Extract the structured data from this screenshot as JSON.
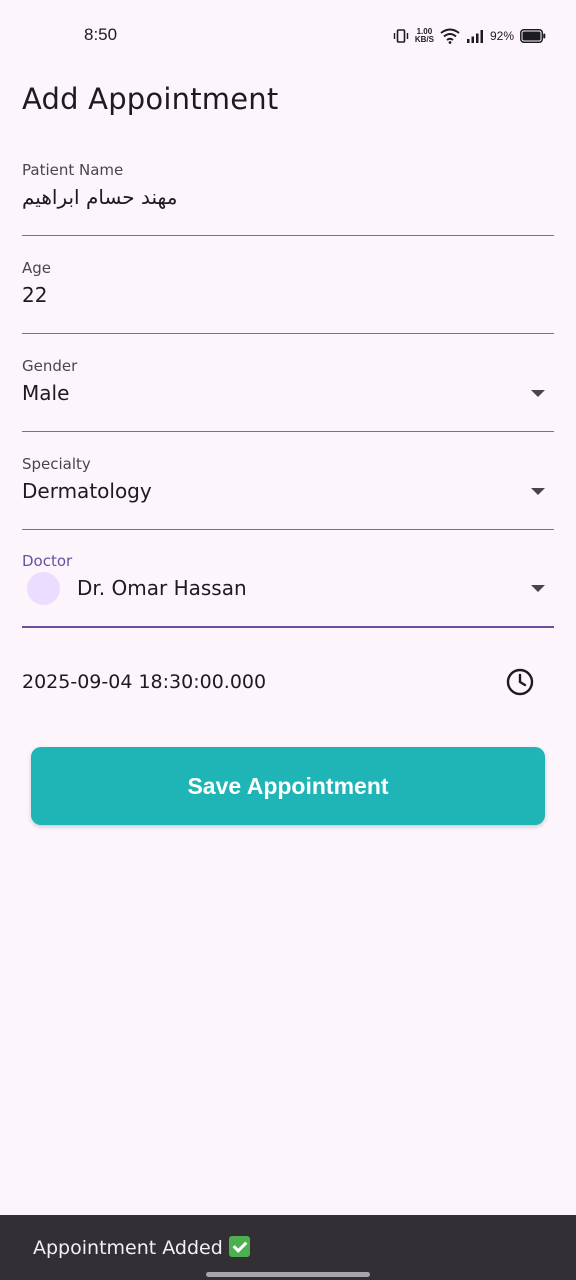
{
  "status_bar": {
    "time": "8:50",
    "net_speed_value": "1.00",
    "net_speed_unit": "KB/S",
    "battery": "92%"
  },
  "page": {
    "title": "Add Appointment"
  },
  "form": {
    "patient_name": {
      "label": "Patient Name",
      "value": "مهند حسام ابراهيم"
    },
    "age": {
      "label": "Age",
      "value": "22"
    },
    "gender": {
      "label": "Gender",
      "value": "Male"
    },
    "specialty": {
      "label": "Specialty",
      "value": "Dermatology"
    },
    "doctor": {
      "label": "Doctor",
      "value": "Dr. Omar Hassan"
    },
    "datetime": {
      "value": "2025-09-04 18:30:00.000"
    }
  },
  "actions": {
    "save_label": "Save Appointment"
  },
  "snackbar": {
    "message": "Appointment Added"
  },
  "colors": {
    "background": "#FCF6FC",
    "accent": "#6750A4",
    "save_button": "#1FB5B6",
    "snackbar": "#322F35"
  }
}
